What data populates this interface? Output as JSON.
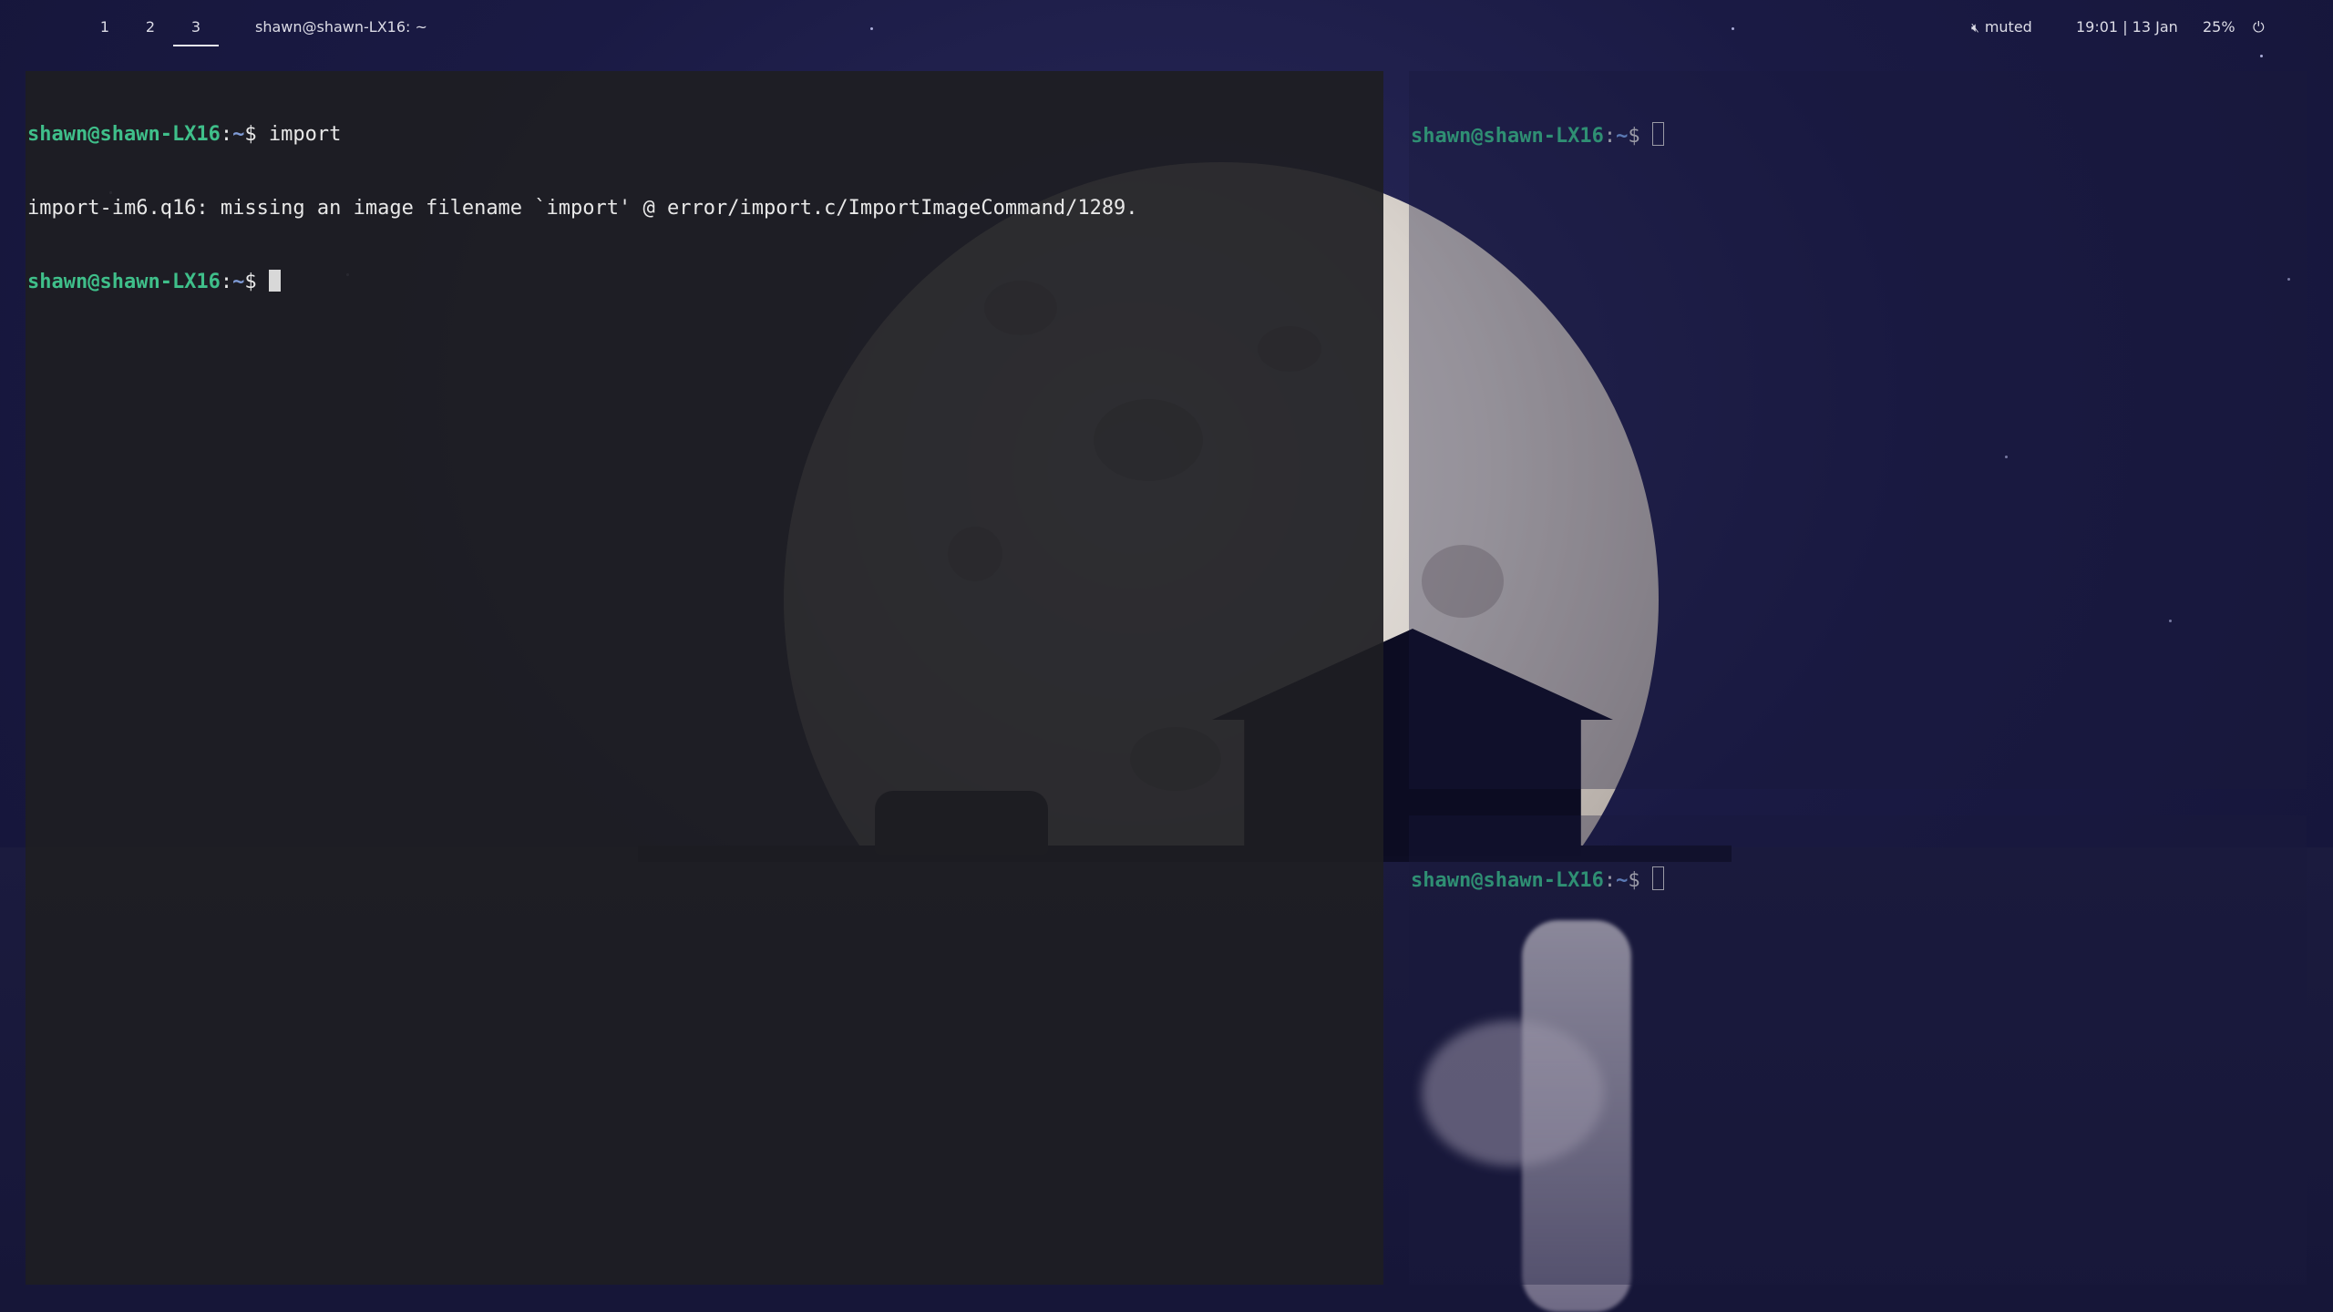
{
  "topbar": {
    "workspaces": [
      {
        "label": "1",
        "active": false
      },
      {
        "label": "2",
        "active": false
      },
      {
        "label": "3",
        "active": true
      }
    ],
    "window_title": "shawn@shawn-LX16: ~",
    "tray": {
      "volume_icon": "speaker-muted-icon",
      "volume_text": "muted",
      "clock": "19:01 | 13 Jan",
      "battery": "25%",
      "power_icon": "power-icon"
    }
  },
  "terminals": {
    "main": {
      "prompt_user": "shawn@shawn-LX16",
      "prompt_sep": ":",
      "prompt_path": "~",
      "prompt_symbol": "$ ",
      "command": "import",
      "output": "import-im6.q16: missing an image filename `import' @ error/import.c/ImportImageCommand/1289."
    },
    "top_right": {
      "prompt_user": "shawn@shawn-LX16",
      "prompt_sep": ":",
      "prompt_path": "~",
      "prompt_symbol": "$ "
    },
    "bottom_right": {
      "prompt_user": "shawn@shawn-LX16",
      "prompt_sep": ":",
      "prompt_path": "~",
      "prompt_symbol": "$ "
    }
  },
  "colors": {
    "prompt_user": "#3fbf8a",
    "prompt_path": "#7f9bd6",
    "terminal_bg": "#1e1e22",
    "wallpaper_sky": "#1a1a44"
  }
}
